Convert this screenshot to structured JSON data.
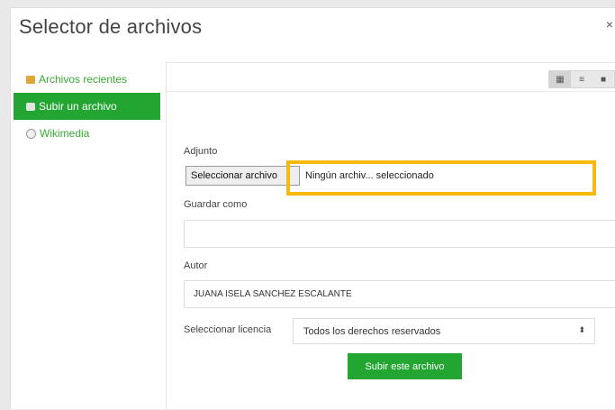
{
  "dialog": {
    "title": "Selector de archivos",
    "close_glyph": "×"
  },
  "sidebar": {
    "items": [
      {
        "label": "Archivos recientes",
        "icon": "recent-files-icon",
        "active": false
      },
      {
        "label": "Subir un archivo",
        "icon": "upload-icon",
        "active": true
      },
      {
        "label": "Wikimedia",
        "icon": "wikimedia-icon",
        "active": false
      }
    ]
  },
  "toolbar": {
    "views": [
      {
        "glyph": "▦",
        "icon": "grid-view-icon",
        "selected": true
      },
      {
        "glyph": "≡",
        "icon": "list-view-icon",
        "selected": false
      },
      {
        "glyph": "■",
        "icon": "folder-view-icon",
        "selected": false
      }
    ]
  },
  "form": {
    "attachment_label": "Adjunto",
    "file_button_label": "Seleccionar archivo",
    "file_status": "Ningún archiv... seleccionado",
    "save_as_label": "Guardar como",
    "save_as_value": "",
    "author_label": "Autor",
    "author_value": "JUANA ISELA SANCHEZ ESCALANTE",
    "license_label": "Seleccionar licencia",
    "license_value": "Todos los derechos reservados",
    "license_caret": "⬍",
    "submit_label": "Subir este archivo"
  },
  "colors": {
    "accent_green": "#22a631",
    "highlight_yellow": "#f6b90d"
  }
}
